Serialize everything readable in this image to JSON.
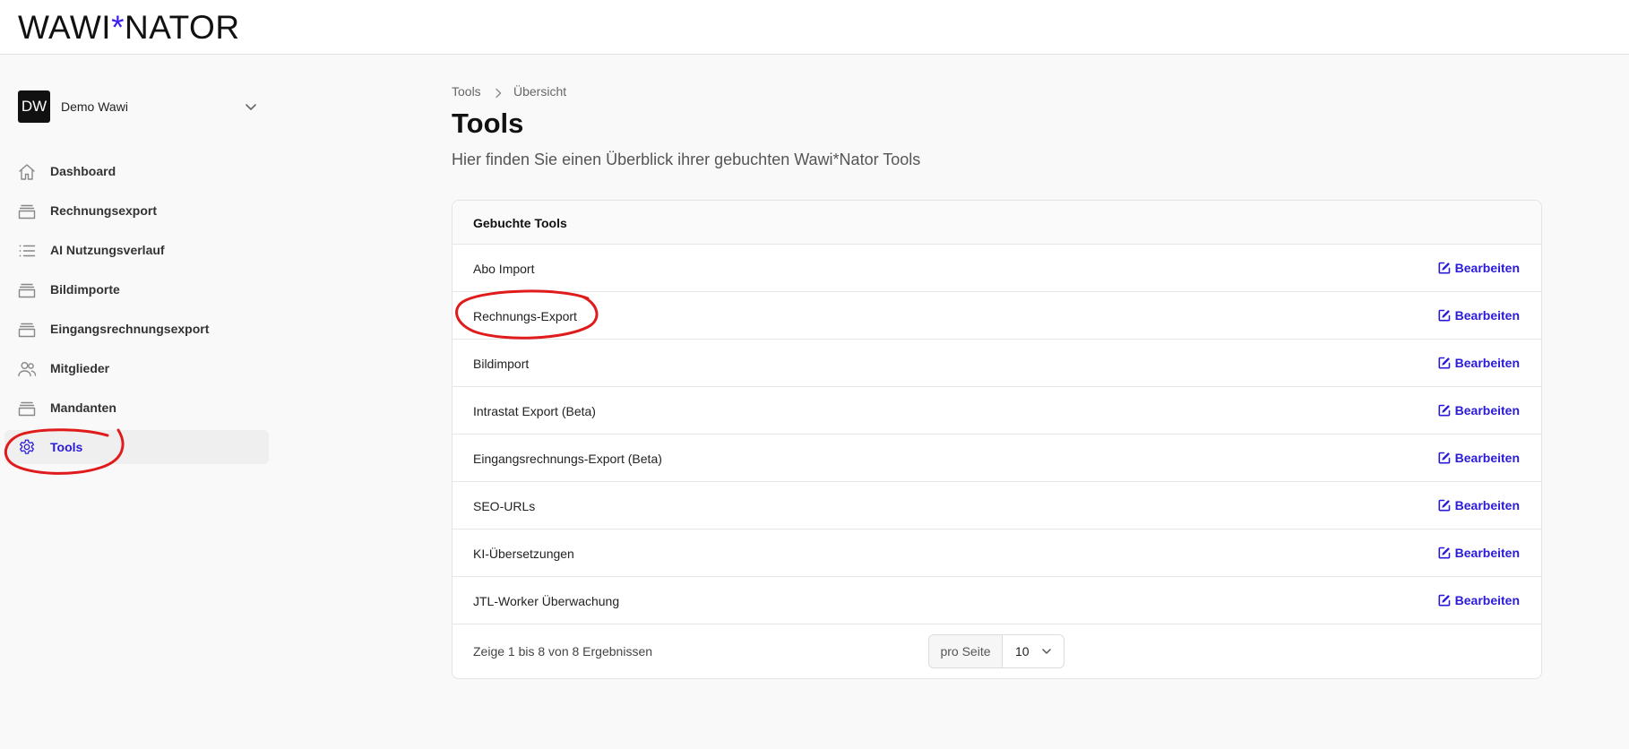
{
  "app": {
    "logo_left": "WAWI",
    "logo_star": "*",
    "logo_right": "NATOR"
  },
  "tenant": {
    "initials": "DW",
    "name": "Demo Wawi"
  },
  "sidebar": {
    "items": [
      {
        "label": "Dashboard",
        "icon": "home-icon"
      },
      {
        "label": "Rechnungsexport",
        "icon": "archive-icon"
      },
      {
        "label": "AI Nutzungsverlauf",
        "icon": "list-icon"
      },
      {
        "label": "Bildimporte",
        "icon": "archive-icon"
      },
      {
        "label": "Eingangsrechnungsexport",
        "icon": "archive-icon"
      },
      {
        "label": "Mitglieder",
        "icon": "users-icon"
      },
      {
        "label": "Mandanten",
        "icon": "archive-icon"
      },
      {
        "label": "Tools",
        "icon": "gear-icon",
        "active": true
      }
    ]
  },
  "breadcrumb": {
    "parent": "Tools",
    "current": "Übersicht"
  },
  "page": {
    "title": "Tools",
    "subtitle": "Hier finden Sie einen Überblick ihrer gebuchten Wawi*Nator Tools"
  },
  "table": {
    "title": "Gebuchte Tools",
    "edit_label": "Bearbeiten",
    "rows": [
      "Abo Import",
      "Rechnungs-Export",
      "Bildimport",
      "Intrastat Export (Beta)",
      "Eingangsrechnungs-Export (Beta)",
      "SEO-URLs",
      "KI-Übersetzungen",
      "JTL-Worker Überwachung"
    ],
    "footer": "Zeige 1 bis 8 von 8 Ergebnissen",
    "per_page_label": "pro Seite",
    "per_page_value": "10"
  },
  "colors": {
    "accent": "#2b1bd8",
    "annotation": "#e01b1b"
  }
}
